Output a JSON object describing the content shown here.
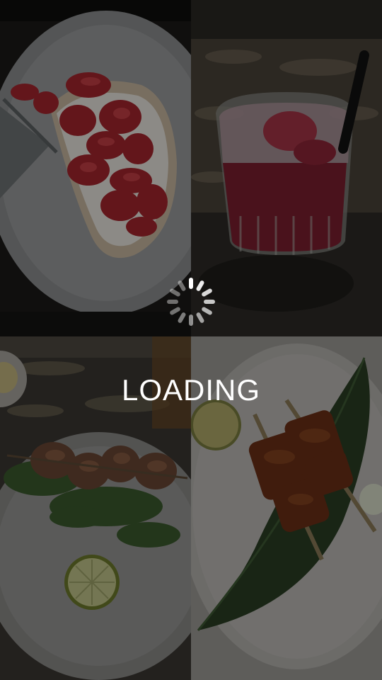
{
  "overlay": {
    "loading_text": "LOADING",
    "spinner_icon": "loading-spinner-icon"
  },
  "photos": [
    {
      "subject": "strawberry-toast-photo"
    },
    {
      "subject": "strawberry-drink-photo"
    },
    {
      "subject": "grilled-shrimp-photo"
    },
    {
      "subject": "glazed-skewers-photo"
    }
  ],
  "colors": {
    "overlay_text": "#ffffff",
    "spinner": "#ffffff",
    "background": "#050505"
  }
}
